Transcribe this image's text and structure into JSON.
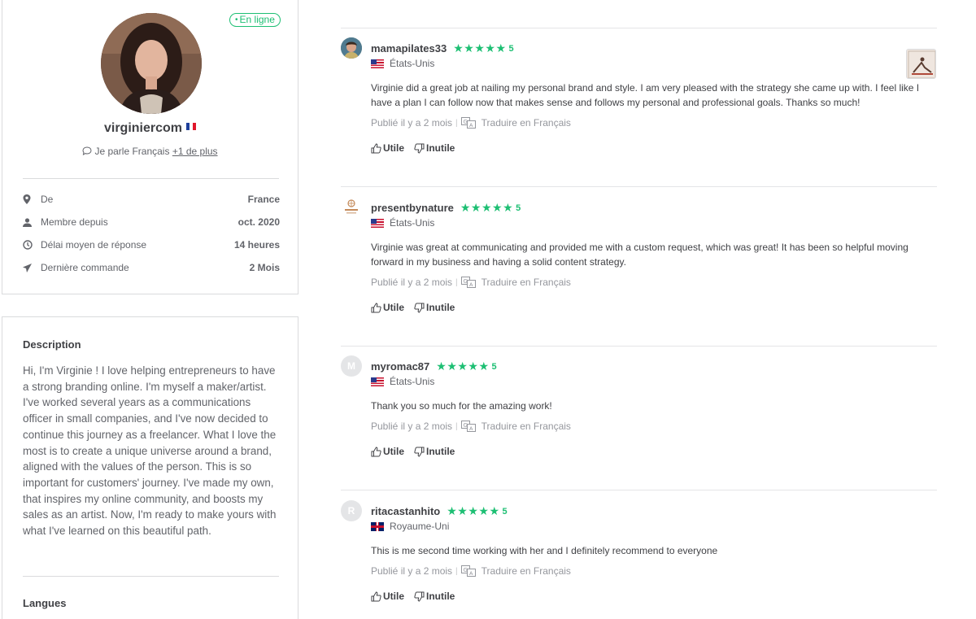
{
  "profile": {
    "status": "En ligne",
    "username": "virginiercom",
    "speaks_prefix": "Je parle Français",
    "speaks_more": "+1 de plus",
    "stats": [
      {
        "icon": "location-pin-icon",
        "label": "De",
        "value": "France"
      },
      {
        "icon": "person-icon",
        "label": "Membre depuis",
        "value": "oct. 2020"
      },
      {
        "icon": "clock-icon",
        "label": "Délai moyen de réponse",
        "value": "14 heures"
      },
      {
        "icon": "paper-plane-icon",
        "label": "Dernière commande",
        "value": "2 Mois"
      }
    ]
  },
  "description": {
    "title": "Description",
    "text": "Hi, I'm Virginie ! I love helping entrepreneurs to have a strong branding online. I'm myself a maker/artist. I've worked several years as a communications officer in small companies, and I've now decided to continue this journey as a freelancer. What I love the most is to create a unique universe around a brand, aligned with the values of the person. This is so important for customers' journey. I've made my own, that inspires my online community, and boosts my sales as an artist. Now, I'm ready to make yours with what I've learned on this beautiful path.",
    "languages_title": "Langues"
  },
  "reviews": [
    {
      "username": "mamapilates33",
      "rating": "5",
      "country": "États-Unis",
      "flag": "us",
      "text": "Virginie did a great job at nailing my personal brand and style. I am very pleased with the strategy she came up with. I feel like I have a plan I can follow now that makes sense and follows my personal and professional goals. Thanks so much!",
      "published": "Publié il y a 2 mois",
      "translate": "Traduire en Français",
      "helpful": "Utile",
      "not_helpful": "Inutile"
    },
    {
      "username": "presentbynature",
      "rating": "5",
      "country": "États-Unis",
      "flag": "us",
      "text": "Virginie was great at communicating and provided me with a custom request, which was great! It has been so helpful moving forward in my business and having a solid content strategy.",
      "published": "Publié il y a 2 mois",
      "translate": "Traduire en Français",
      "helpful": "Utile",
      "not_helpful": "Inutile"
    },
    {
      "username": "myromac87",
      "avatar_letter": "M",
      "rating": "5",
      "country": "États-Unis",
      "flag": "us",
      "text": "Thank you so much for the amazing work!",
      "published": "Publié il y a 2 mois",
      "translate": "Traduire en Français",
      "helpful": "Utile",
      "not_helpful": "Inutile"
    },
    {
      "username": "ritacastanhito",
      "avatar_letter": "R",
      "rating": "5",
      "country": "Royaume-Uni",
      "flag": "gb",
      "text": "This is me second time working with her and I definitely recommend to everyone",
      "published": "Publié il y a 2 mois",
      "translate": "Traduire en Français",
      "helpful": "Utile",
      "not_helpful": "Inutile"
    }
  ],
  "colors": {
    "accent": "#1dbf73",
    "text": "#404145",
    "muted": "#62646a",
    "border": "#dadbdd"
  }
}
